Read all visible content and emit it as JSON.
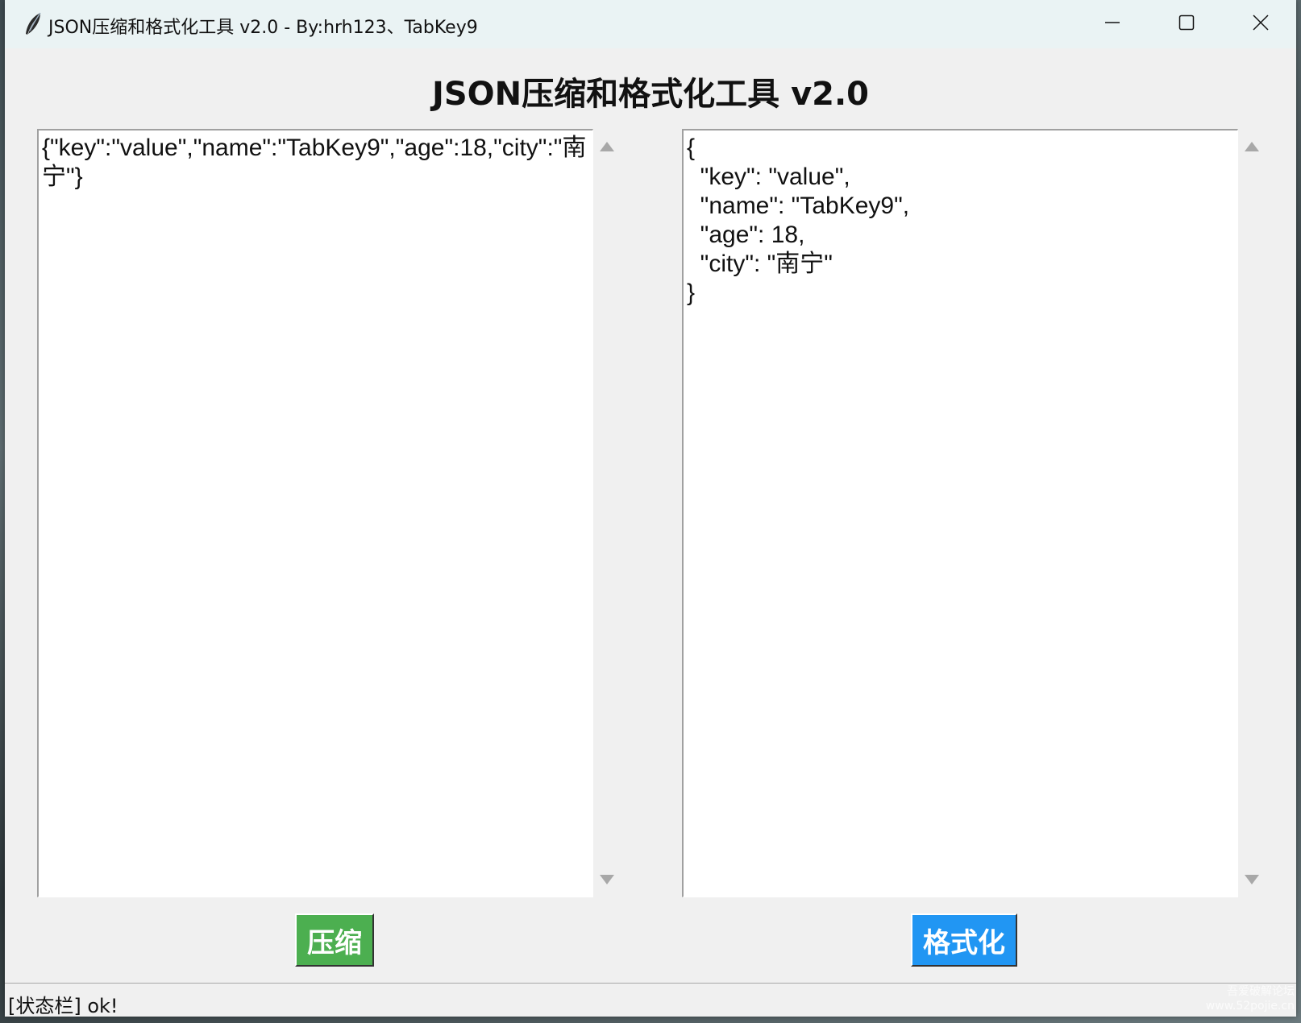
{
  "window": {
    "title": "JSON压缩和格式化工具 v2.0 - By:hrh123、TabKey9",
    "icon": "feather-icon"
  },
  "window_controls": {
    "minimize_icon": "minimize-icon",
    "maximize_icon": "maximize-icon",
    "close_icon": "close-icon"
  },
  "heading": "JSON压缩和格式化工具 v2.0",
  "input_text": "{\"key\":\"value\",\"name\":\"TabKey9\",\"age\":18,\"city\":\"南宁\"}",
  "output_text": "{\n  \"key\": \"value\",\n  \"name\": \"TabKey9\",\n  \"age\": 18,\n  \"city\": \"南宁\"\n}",
  "buttons": {
    "compress": "压缩",
    "format": "格式化"
  },
  "colors": {
    "compress_bg": "#4caf50",
    "format_bg": "#2196f3"
  },
  "status": "[状态栏] ok!",
  "watermark": {
    "line1": "吾爱破解论坛",
    "line2": "www.52pojie.cn"
  }
}
